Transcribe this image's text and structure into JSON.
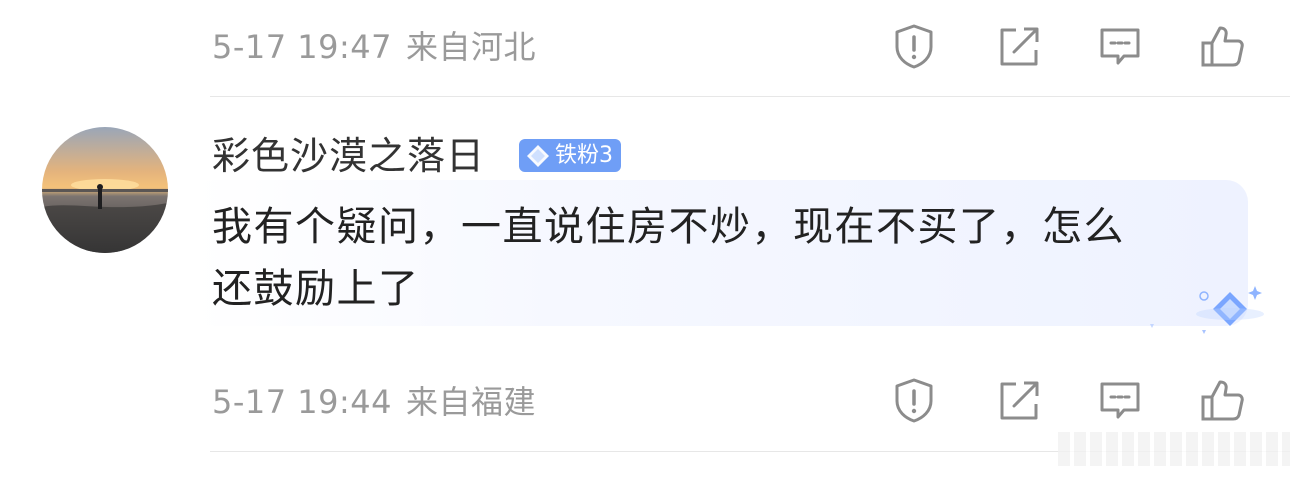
{
  "comments": [
    {
      "time": "5-17 19:47",
      "location": "来自河北"
    },
    {
      "username": "彩色沙漠之落日",
      "badge": "铁粉3",
      "content_line1": "我有个疑问，一直说住房不炒，现在不买了，怎么",
      "content_line2": "还鼓励上了",
      "time": "5-17 19:44",
      "location": "来自福建"
    }
  ],
  "action_icons": [
    "report-icon",
    "share-icon",
    "comment-icon",
    "like-icon"
  ],
  "colors": {
    "meta_text": "#9a9a9a",
    "username": "#333333",
    "content": "#222222",
    "badge_bg": "#6f9ef6",
    "icon_stroke": "#8c8c8c",
    "divider": "#e7e7e7"
  }
}
